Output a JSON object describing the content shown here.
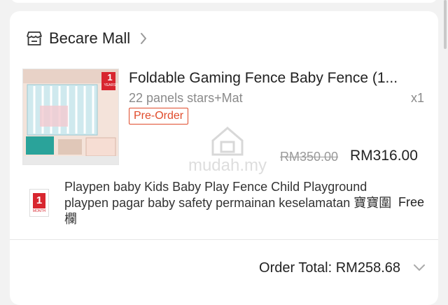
{
  "shop": {
    "name": "Becare Mall"
  },
  "product": {
    "title": "Foldable Gaming Fence Baby Fence (1...",
    "variant": "22 panels stars+Mat",
    "quantity": "x1",
    "badge": "Pre-Order",
    "original_price": "RM350.00",
    "price": "RM316.00",
    "thumbnail": {
      "badge_year": "1",
      "badge_label": "YEARS"
    }
  },
  "watermark": {
    "text": "mudah.my"
  },
  "gift": {
    "badge_number": "1",
    "badge_label": "MONTH",
    "description": "Playpen baby Kids Baby Play Fence Child Playground playpen pagar baby safety permainan keselamatan 寶寶圍欄",
    "price": "Free"
  },
  "order_total": {
    "label": "Order Total: RM258.68"
  },
  "colors": {
    "accent": "#e04b2b",
    "muted_text": "#8a8a8a",
    "background": "#f2f2f2"
  },
  "icons": {
    "shop": "storefront-icon",
    "shop_chevron": "chevron-right-icon",
    "total_chevron": "chevron-down-icon"
  }
}
